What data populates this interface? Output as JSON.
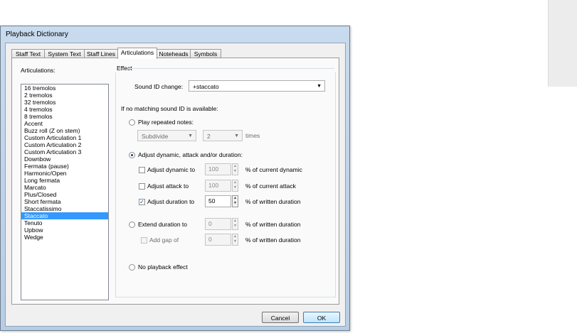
{
  "window": {
    "title": "Playback Dictionary"
  },
  "tabs": [
    {
      "label": "Staff Text"
    },
    {
      "label": "System Text"
    },
    {
      "label": "Staff Lines"
    },
    {
      "label": "Articulations"
    },
    {
      "label": "Noteheads"
    },
    {
      "label": "Symbols"
    }
  ],
  "active_tab": "Articulations",
  "list": {
    "label": "Articulations:",
    "items": [
      "16 tremolos",
      "2 tremolos",
      "32 tremolos",
      "4 tremolos",
      "8 tremolos",
      "Accent",
      "Buzz roll (Z on stem)",
      "Custom Articulation 1",
      "Custom Articulation 2",
      "Custom Articulation 3",
      "Downbow",
      "Fermata (pause)",
      "Harmonic/Open",
      "Long fermata",
      "Marcato",
      "Plus/Closed",
      "Short fermata",
      "Staccatissimo",
      "Staccato",
      "Tenuto",
      "Upbow",
      "Wedge"
    ],
    "selected": "Staccato"
  },
  "effect": {
    "group_label": "Effect",
    "sound_id_label": "Sound ID change:",
    "sound_id_value": "+staccato",
    "no_match_text": "If no matching sound ID is available:",
    "play_repeated": {
      "label": "Play repeated notes:",
      "mode_value": "Subdivide",
      "count_value": "2",
      "suffix": "times"
    },
    "adjust": {
      "label": "Adjust dynamic, attack and/or duration:",
      "dynamic": {
        "label": "Adjust dynamic to",
        "value": "100",
        "suffix": "% of current dynamic",
        "checked": false
      },
      "attack": {
        "label": "Adjust attack to",
        "value": "100",
        "suffix": "% of current attack",
        "checked": false
      },
      "duration": {
        "label": "Adjust duration to",
        "value": "50",
        "suffix": "% of written duration",
        "checked": true
      }
    },
    "extend": {
      "label": "Extend duration to",
      "value": "0",
      "suffix": "% of written duration",
      "gap": {
        "label": "Add gap of",
        "value": "0",
        "suffix": "% of written duration"
      }
    },
    "no_effect_label": "No playback effect",
    "selected_option": "adjust"
  },
  "buttons": {
    "cancel": "Cancel",
    "ok": "OK"
  },
  "icons": {
    "dropdown": "chevron-down-icon",
    "spin": "spin-arrows-icon",
    "check": "check-icon"
  },
  "colors": {
    "selection": "#3399ff",
    "title_bar": "#c9dbee"
  }
}
